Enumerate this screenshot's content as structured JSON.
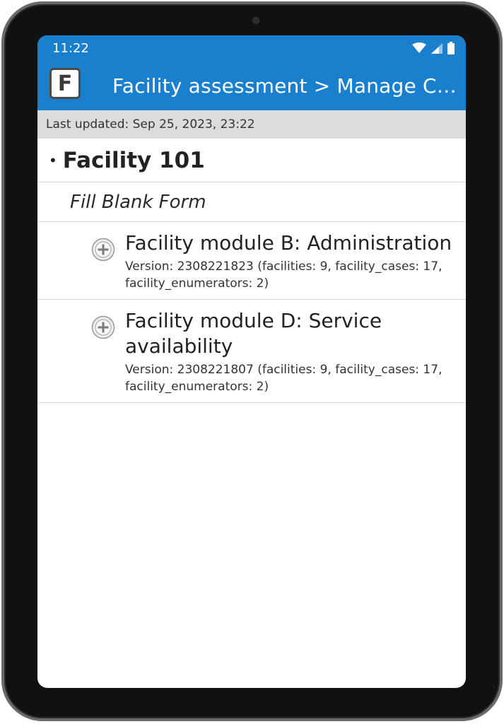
{
  "status_bar": {
    "time": "11:22",
    "icons": [
      "wifi-icon",
      "signal-icon",
      "battery-icon"
    ]
  },
  "app_bar": {
    "logo_letter": "F",
    "title": "Facility assessment > Manage Cases"
  },
  "last_updated": "Last updated: Sep 25, 2023, 23:22",
  "group": {
    "bullet": "•",
    "title": "Facility 101"
  },
  "section": {
    "label": "Fill Blank Form"
  },
  "forms": [
    {
      "title": "Facility module B: Administration",
      "version": "Version: 2308221823 (facilities: 9, facility_cases: 17, facility_enumerators: 2)",
      "icon": "add-circle-icon"
    },
    {
      "title": "Facility module D: Service availability",
      "version": "Version: 2308221807 (facilities: 9, facility_cases: 17, facility_enumerators: 2)",
      "icon": "add-circle-icon"
    }
  ],
  "colors": {
    "primary": "#1a7fcc",
    "header_bg": "#dcdcdc",
    "divider": "#d6d6d6",
    "bezel": "#111111"
  }
}
